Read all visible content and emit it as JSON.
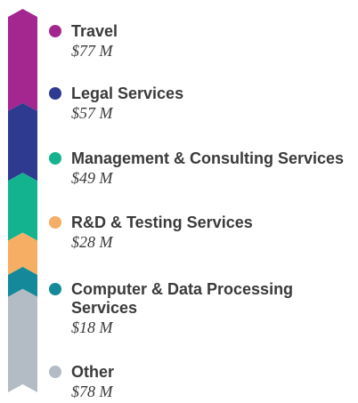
{
  "chart_data": {
    "type": "bar",
    "orientation": "stacked-vertical",
    "unit": "$M",
    "categories": [
      "Travel",
      "Legal Services",
      "Management & Consulting Services",
      "R&D & Testing Services",
      "Computer & Data Processing Services",
      "Other"
    ],
    "values": [
      77,
      57,
      49,
      28,
      18,
      78
    ],
    "value_labels": [
      "$77 M",
      "$57 M",
      "$49 M",
      "$28 M",
      "$18 M",
      "$78 M"
    ],
    "colors": [
      "#a3278f",
      "#2e3a8f",
      "#14b38f",
      "#f5ae63",
      "#14899a",
      "#b3bcc4"
    ],
    "legend": "right"
  }
}
